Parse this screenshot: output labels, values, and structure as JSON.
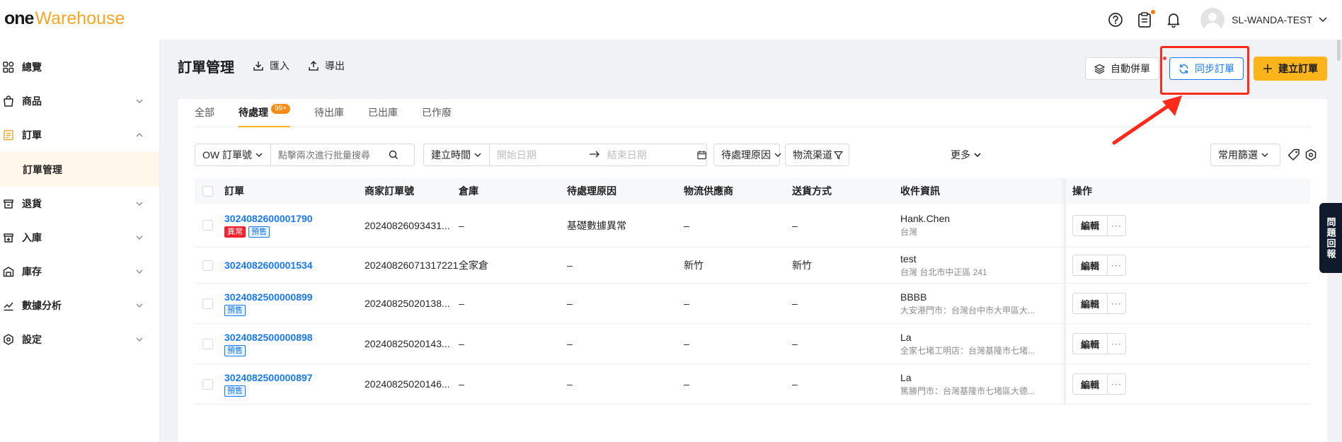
{
  "brand": {
    "one": "one",
    "warehouse": "Warehouse"
  },
  "user": {
    "name": "SL-WANDA-TEST"
  },
  "sidebar": {
    "items": [
      {
        "label": "總覽",
        "icon": "grid-icon"
      },
      {
        "label": "商品",
        "icon": "bag-icon"
      },
      {
        "label": "訂單",
        "icon": "order-icon"
      },
      {
        "label": "訂單管理"
      },
      {
        "label": "退貨",
        "icon": "return-icon"
      },
      {
        "label": "入庫",
        "icon": "inbound-icon"
      },
      {
        "label": "庫存",
        "icon": "warehouse-icon"
      },
      {
        "label": "數據分析",
        "icon": "chart-icon"
      },
      {
        "label": "設定",
        "icon": "settings-icon"
      }
    ]
  },
  "header": {
    "title": "訂單管理",
    "import_label": "匯入",
    "export_label": "導出",
    "auto_merge_label": "自動併單",
    "sync_label": "同步訂單",
    "create_label": "建立訂單"
  },
  "tabs": [
    {
      "label": "全部"
    },
    {
      "label": "待處理",
      "badge": "99+"
    },
    {
      "label": "待出庫"
    },
    {
      "label": "已出庫"
    },
    {
      "label": "已作廢"
    }
  ],
  "filters": {
    "order_type": "OW 訂單號",
    "search_placeholder": "點擊兩次進行批量搜尋",
    "time_type": "建立時間",
    "start_placeholder": "開始日期",
    "end_placeholder": "結束日期",
    "pending_reason": "待處理原因",
    "logistics_channel": "物流渠道",
    "more": "更多",
    "common_filter": "常用篩選"
  },
  "table": {
    "headers": [
      "訂單",
      "商家訂單號",
      "倉庫",
      "待處理原因",
      "物流供應商",
      "送貨方式",
      "收件資訊",
      "操作"
    ],
    "rows": [
      {
        "order": "3024082600001790",
        "tags": [
          "異常",
          "預售"
        ],
        "merchant": "20240826093431...",
        "warehouse": "–",
        "reason": "基礎數據異常",
        "supplier": "–",
        "delivery": "–",
        "recv_name": "Hank.Chen",
        "recv_addr": "台灣"
      },
      {
        "order": "3024082600001534",
        "tags": [],
        "merchant": "20240826071317221",
        "warehouse": "全家倉",
        "reason": "–",
        "supplier": "新竹",
        "delivery": "新竹",
        "recv_name": "test",
        "recv_addr": "台灣 台北市中正區 241"
      },
      {
        "order": "3024082500000899",
        "tags": [
          "預售"
        ],
        "merchant": "20240825020138...",
        "warehouse": "–",
        "reason": "–",
        "supplier": "–",
        "delivery": "–",
        "recv_name": "BBBB",
        "recv_addr": "大安港門市：台灣台中市大甲區大..."
      },
      {
        "order": "3024082500000898",
        "tags": [
          "預售"
        ],
        "merchant": "20240825020143...",
        "warehouse": "–",
        "reason": "–",
        "supplier": "–",
        "delivery": "–",
        "recv_name": "La",
        "recv_addr": "全家七堵工明店：台灣基隆市七堵..."
      },
      {
        "order": "3024082500000897",
        "tags": [
          "預售"
        ],
        "merchant": "20240825020146...",
        "warehouse": "–",
        "reason": "–",
        "supplier": "–",
        "delivery": "–",
        "recv_name": "La",
        "recv_addr": "篤勝門市：台灣基隆市七堵區大德..."
      }
    ],
    "edit_label": "編輯",
    "more_label": "···"
  },
  "feedback_label": "問題回報",
  "colors": {
    "accent": "#fbb41a",
    "link": "#1677ff",
    "highlight": "#ff2a1a"
  }
}
